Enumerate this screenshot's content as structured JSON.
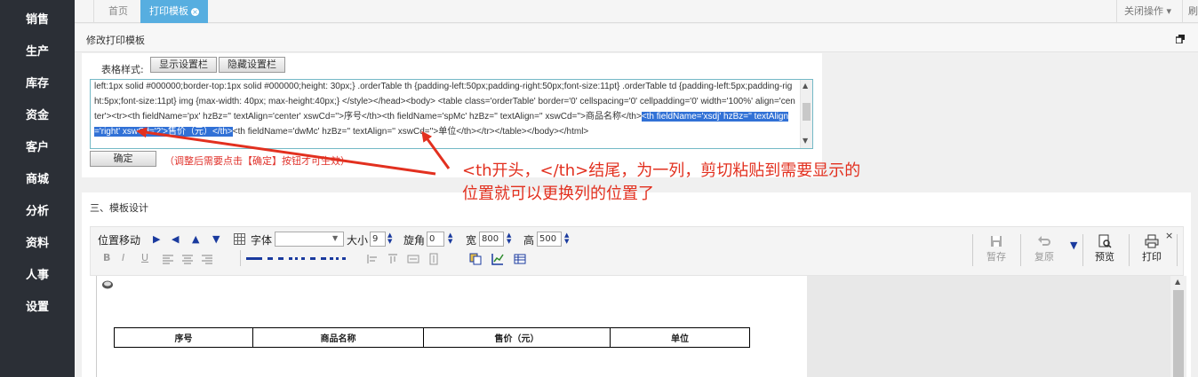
{
  "sidebar": {
    "items": [
      {
        "label": "销售"
      },
      {
        "label": "生产"
      },
      {
        "label": "库存"
      },
      {
        "label": "资金"
      },
      {
        "label": "客户"
      },
      {
        "label": "商城"
      },
      {
        "label": "分析"
      },
      {
        "label": "资料"
      },
      {
        "label": "人事"
      },
      {
        "label": "设置"
      }
    ]
  },
  "tabs": {
    "home": "首页",
    "active": "打印模板",
    "close_glyph": "×",
    "close_ops": "关闭操作 ▾",
    "refresh": "刷"
  },
  "panel": {
    "title": "修改打印模板"
  },
  "style_editor": {
    "label": "表格样式:",
    "show_button": "显示设置栏",
    "hide_button": "隐藏设置栏",
    "code_before": "left:1px solid #000000;border-top:1px solid #000000;height: 30px;} .orderTable th {padding-left:50px;padding-right:50px;font-size:11pt} .orderTable td {padding-left:5px;padding-right:5px;font-size:11pt} img {max-width: 40px; max-height:40px;} </style></head><body> <table class='orderTable' border='0' cellspacing='0' cellpadding='0' width='100%' align='center'><tr><th fieldName='px' hzBz='' textAlign='center' xswCd=''>序号</th><th fieldName='spMc' hzBz='' textAlign='' xswCd=''>商品名称</th>",
    "code_selected": "<th fieldName='xsdj' hzBz='' textAlign='right' xswCd='2'>售价（元）</th>",
    "code_after": "<th fieldName='dwMc' hzBz='' textAlign='' xswCd=''>单位</th></tr></table></body></html>",
    "confirm_button": "确定",
    "hint": "（调整后需要点击【确定】按钮才可生效）"
  },
  "annotation": {
    "line1": "<th开头，</th>结尾，为一列，剪切粘贴到需要显示的",
    "line2": "位置就可以更换列的位置了",
    "color": "#e2301f"
  },
  "design": {
    "title": "三、模板设计",
    "position_label": "位置移动",
    "font_label": "字体",
    "font_value": "",
    "size_label": "大小",
    "size_value": "9",
    "corner_label": "旋角",
    "corner_value": "0",
    "width_label": "宽",
    "width_value": "800",
    "height_label": "高",
    "height_value": "500",
    "format_buttons": [
      "B",
      "I",
      "U"
    ],
    "save_button": "暂存",
    "restore_button": "复原",
    "preview_button": "预览",
    "print_button": "打印",
    "close_glyph": "×",
    "table_headers": [
      "序号",
      "商品名称",
      "售价（元）",
      "单位"
    ]
  },
  "colors": {
    "sidebar_bg": "#2b2f36",
    "active_tab": "#57aee0",
    "selection": "#3171d6",
    "hint_red": "#e0332c"
  }
}
